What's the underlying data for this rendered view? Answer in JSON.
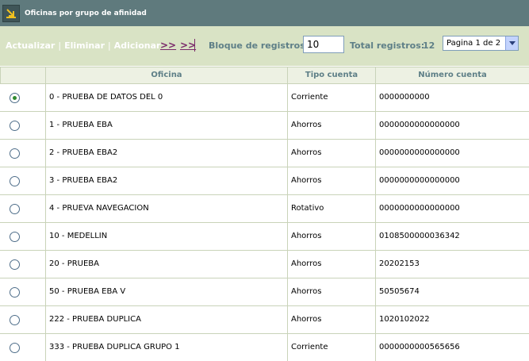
{
  "window": {
    "title": "Oficinas por grupo de afinidad",
    "icon": "sort-arrow-icon"
  },
  "toolbar": {
    "actualizar": "Actualizar",
    "eliminar": "Eliminar",
    "adicionar": "Adicionar",
    "separator": "|",
    "next": ">>",
    "last": ">>",
    "block_label": "Bloque de registros:",
    "block_value": "10",
    "total_label": "Total registros:",
    "total_value": "12",
    "page_select": "Pagina 1 de 2"
  },
  "table": {
    "headers": [
      "",
      "Oficina",
      "Tipo cuenta",
      "Número cuenta"
    ],
    "rows": [
      {
        "selected": true,
        "oficina": "0 - PRUEBA DE DATOS DEL 0",
        "tipo": "Corriente",
        "numero": "0000000000"
      },
      {
        "selected": false,
        "oficina": "1 - PRUEBA EBA",
        "tipo": "Ahorros",
        "numero": "0000000000000000"
      },
      {
        "selected": false,
        "oficina": "2 - PRUEBA EBA2",
        "tipo": "Ahorros",
        "numero": "0000000000000000"
      },
      {
        "selected": false,
        "oficina": "3 - PRUEBA EBA2",
        "tipo": "Ahorros",
        "numero": "0000000000000000"
      },
      {
        "selected": false,
        "oficina": "4 - PRUEVA NAVEGACION",
        "tipo": "Rotativo",
        "numero": "0000000000000000"
      },
      {
        "selected": false,
        "oficina": "10 - MEDELLIN",
        "tipo": "Ahorros",
        "numero": "0108500000036342"
      },
      {
        "selected": false,
        "oficina": "20 - PRUEBA",
        "tipo": "Ahorros",
        "numero": "20202153"
      },
      {
        "selected": false,
        "oficina": "50 - PRUEBA EBA V",
        "tipo": "Ahorros",
        "numero": "50505674"
      },
      {
        "selected": false,
        "oficina": "222 - PRUEBA DUPLICA",
        "tipo": "Ahorros",
        "numero": "1020102022"
      },
      {
        "selected": false,
        "oficina": "333 - PRUEBA DUPLICA GRUPO 1",
        "tipo": "Corriente",
        "numero": "0000000000565656"
      }
    ]
  },
  "colors": {
    "titlebar": "#5f7a7d",
    "toolbar": "#d9e3c5",
    "label": "#5e7f87",
    "nav_link": "#7a2a6a"
  }
}
